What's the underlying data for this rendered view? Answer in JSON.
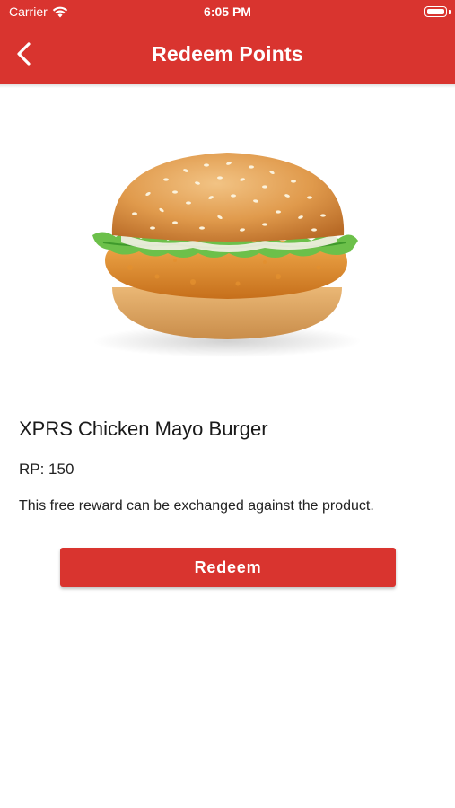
{
  "status_bar": {
    "carrier": "Carrier",
    "time": "6:05 PM",
    "wifi_icon": "wifi-icon",
    "battery_icon": "battery-icon"
  },
  "header": {
    "title": "Redeem Points",
    "back_icon": "chevron-left-icon",
    "background_color": "#d9342f"
  },
  "product": {
    "image": "burger-image",
    "name": "XPRS Chicken Mayo Burger",
    "points": "RP: 150",
    "description": "This free reward can be exchanged against the product."
  },
  "actions": {
    "redeem_label": "Redeem",
    "accent_color": "#d9342f"
  }
}
